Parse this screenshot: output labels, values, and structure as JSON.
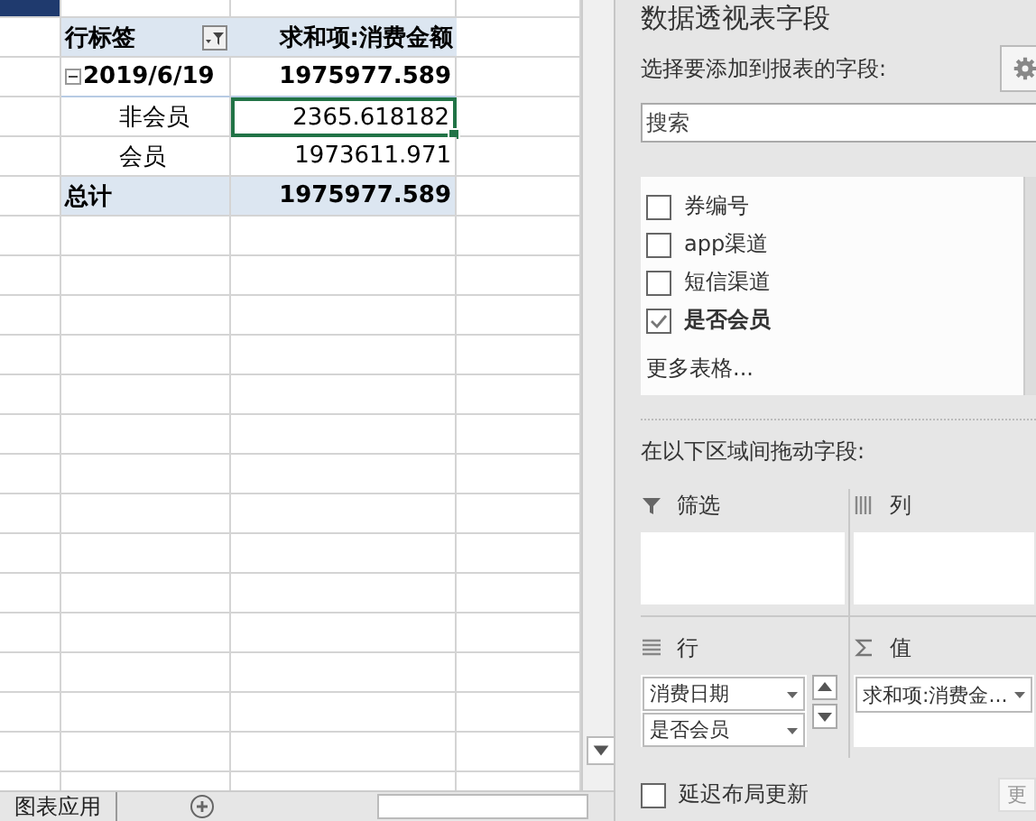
{
  "pivot": {
    "header": {
      "row_label": "行标签",
      "value_label": "求和项:消费金额"
    },
    "rows": [
      {
        "kind": "group",
        "label": "2019/6/19",
        "value": "1975977.589",
        "expanded": true,
        "selected": false
      },
      {
        "kind": "item",
        "label": "非会员",
        "value": "2365.618182",
        "selected": true
      },
      {
        "kind": "item",
        "label": "会员",
        "value": "1973611.971",
        "selected": false
      },
      {
        "kind": "total",
        "label": "总计",
        "value": "1975977.589",
        "selected": false
      }
    ]
  },
  "sheet_tabs": [
    {
      "label": "图表应用"
    }
  ],
  "field_panel": {
    "title": "数据透视表字段",
    "prompt": "选择要添加到报表的字段:",
    "search": {
      "placeholder": "搜索"
    },
    "fields": [
      {
        "label": "券编号",
        "checked": false
      },
      {
        "label": "app渠道",
        "checked": false
      },
      {
        "label": "短信渠道",
        "checked": false
      },
      {
        "label": "是否会员",
        "checked": true
      }
    ],
    "more": "更多表格...",
    "areas_prompt": "在以下区域间拖动字段:",
    "areas": [
      {
        "kind": "filter",
        "label": "筛选"
      },
      {
        "kind": "columns",
        "label": "列"
      },
      {
        "kind": "rows",
        "label": "行",
        "items": [
          "消费日期",
          "是否会员"
        ]
      },
      {
        "kind": "values",
        "label": "值",
        "items": [
          "求和项:消费金..."
        ]
      }
    ],
    "defer_update": {
      "label": "延迟布局更新",
      "checked": false
    },
    "update_button": "更"
  }
}
